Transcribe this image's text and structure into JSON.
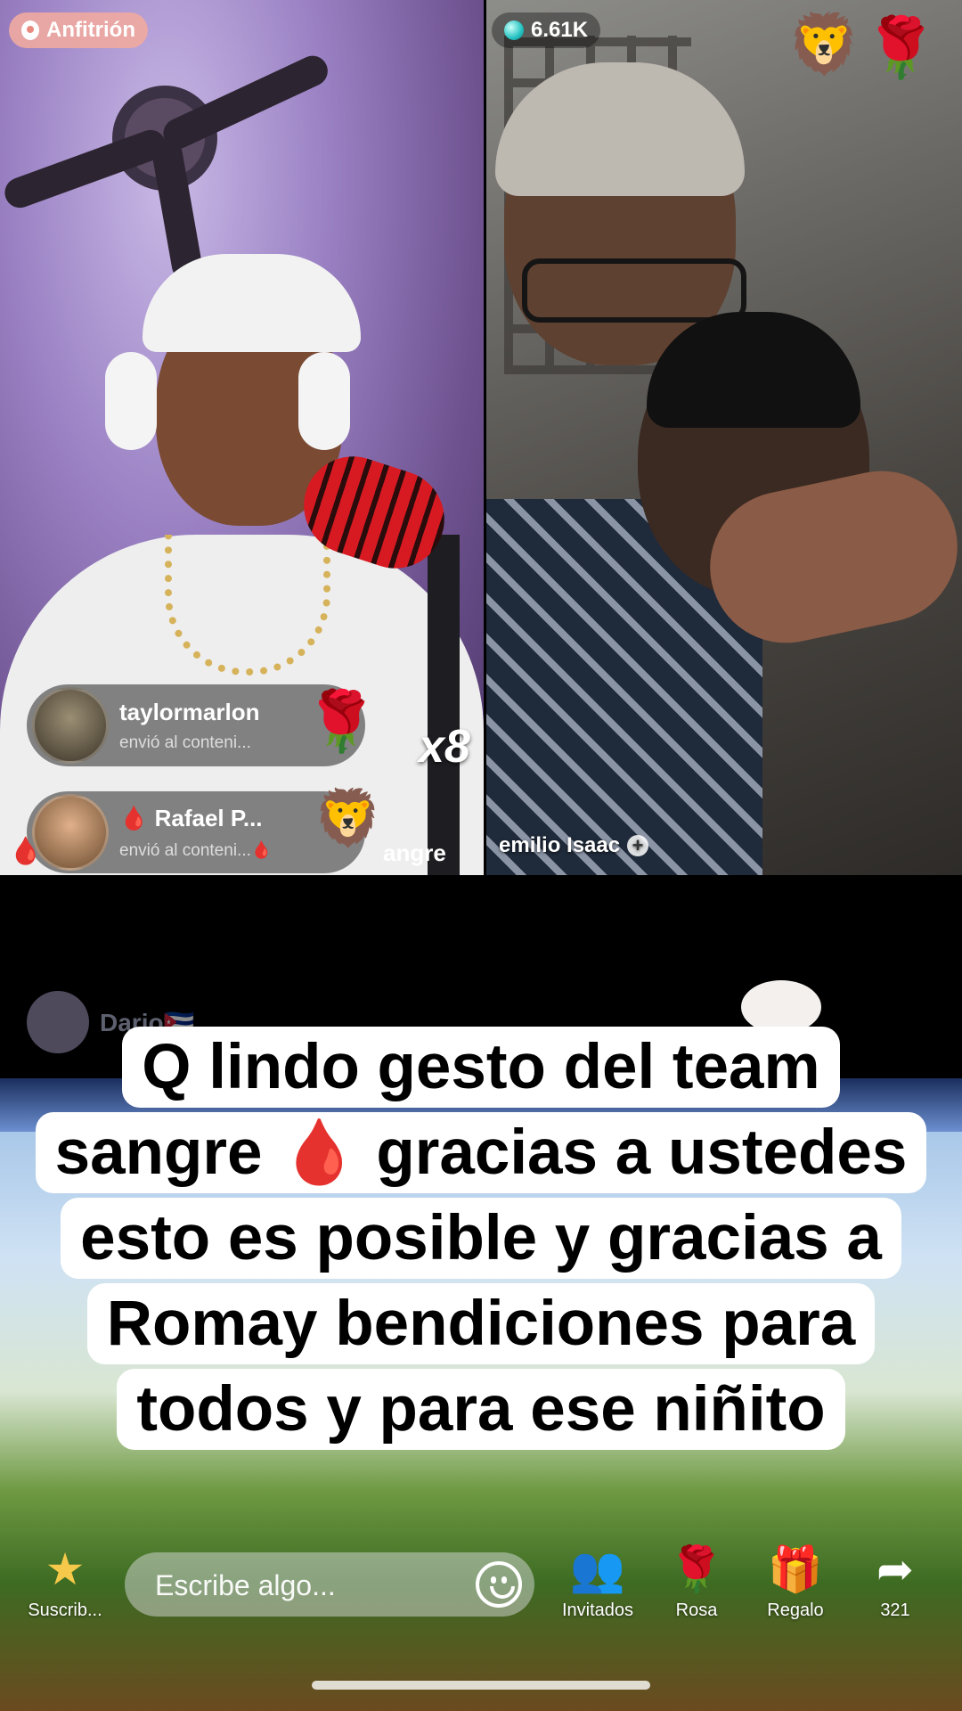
{
  "left_panel": {
    "host_badge": "Anfitrión",
    "gift_combo": "x8",
    "gifts": [
      {
        "user": "taylormarlon",
        "message": "envió al conteni...",
        "gift_icon": "rose-icon"
      },
      {
        "user": "Rafael P...",
        "message": "envió al conteni...",
        "gift_icon": "lion-icon",
        "trailing_text": "angre"
      }
    ]
  },
  "right_panel": {
    "viewer_count": "6.61K",
    "top_gifts": [
      "lion-icon",
      "rose-icon"
    ],
    "guest_name": "emilio Isaac"
  },
  "chat": {
    "partial_user": "Dario🇨🇺"
  },
  "caption": {
    "lines": [
      "Q lindo gesto del team",
      "sangre 🩸 gracias a ustedes",
      "esto es posible y gracias a",
      "Romay bendiciones para",
      "todos y para ese niñito"
    ]
  },
  "bottom_bar": {
    "subscribe_label": "Suscrib...",
    "comment_placeholder": "Escribe algo...",
    "guests_label": "Invitados",
    "rose_label": "Rosa",
    "gift_label": "Regalo",
    "share_count": "321"
  },
  "colors": {
    "host_badge_bg": "#f0aaa0",
    "drop": "#d0131d",
    "viewer_gem": "#25c3c2"
  }
}
